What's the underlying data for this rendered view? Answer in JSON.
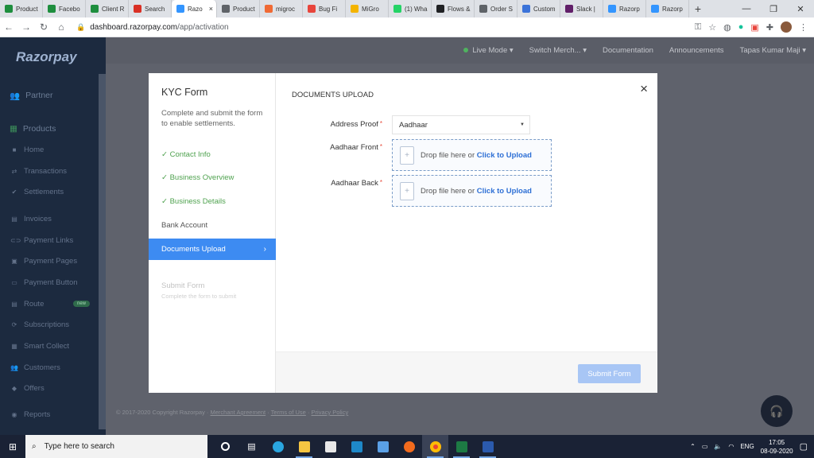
{
  "browser": {
    "tabs": [
      {
        "label": "Product",
        "color": "#1e8e3e"
      },
      {
        "label": "Facebo",
        "color": "#1e8e3e"
      },
      {
        "label": "Client R",
        "color": "#1e8e3e"
      },
      {
        "label": "Search",
        "color": "#d93025"
      },
      {
        "label": "Razo",
        "color": "#3395ff",
        "active": true
      },
      {
        "label": "Product",
        "color": "#5f6368"
      },
      {
        "label": "migroc",
        "color": "#f06a35"
      },
      {
        "label": "Bug Fi",
        "color": "#e8453c"
      },
      {
        "label": "MiGro",
        "color": "#f4b400"
      },
      {
        "label": "(1) Wha",
        "color": "#25d366"
      },
      {
        "label": "Flows &",
        "color": "#202124"
      },
      {
        "label": "Order S",
        "color": "#5f6368"
      },
      {
        "label": "Custom",
        "color": "#3b73d9"
      },
      {
        "label": "Slack |",
        "color": "#611f69"
      },
      {
        "label": "Razorp",
        "color": "#3395ff"
      },
      {
        "label": "Razorp",
        "color": "#3395ff"
      }
    ],
    "active_tab_close": "×",
    "new_tab": "+",
    "url_host": "dashboard.razorpay.com",
    "url_path": "/app/activation"
  },
  "sidebar": {
    "logo": "Razorpay",
    "partner": "Partner",
    "products": "Products",
    "items": [
      {
        "label": "Home",
        "icon": "home-icon",
        "glyph": "■"
      },
      {
        "label": "Transactions",
        "icon": "transactions-icon",
        "glyph": "⇄"
      },
      {
        "label": "Settlements",
        "icon": "settlements-icon",
        "glyph": "✔"
      },
      {
        "label": "Invoices",
        "icon": "invoices-icon",
        "glyph": "▤"
      },
      {
        "label": "Payment Links",
        "icon": "link-icon",
        "glyph": "⊂⊃"
      },
      {
        "label": "Payment Pages",
        "icon": "pages-icon",
        "glyph": "▣"
      },
      {
        "label": "Payment Button",
        "icon": "button-icon",
        "glyph": "▭"
      },
      {
        "label": "Route",
        "icon": "route-icon",
        "glyph": "▤",
        "badge": "new"
      },
      {
        "label": "Subscriptions",
        "icon": "subscriptions-icon",
        "glyph": "⟳"
      },
      {
        "label": "Smart Collect",
        "icon": "smart-collect-icon",
        "glyph": "▦"
      },
      {
        "label": "Customers",
        "icon": "customers-icon",
        "glyph": "👥"
      },
      {
        "label": "Offers",
        "icon": "offers-icon",
        "glyph": "◆"
      },
      {
        "label": "Reports",
        "icon": "reports-icon",
        "glyph": "◉"
      }
    ]
  },
  "topbar": {
    "live_mode": "Live Mode ▾",
    "switch_merchant": "Switch Merch... ▾",
    "documentation": "Documentation",
    "announcements": "Announcements",
    "user": "Tapas Kumar Maji ▾"
  },
  "modal": {
    "title": "KYC Form",
    "subtitle": "Complete and submit the form to enable settlements.",
    "steps": [
      {
        "label": "✓  Contact Info",
        "state": "done"
      },
      {
        "label": "✓  Business Overview",
        "state": "done"
      },
      {
        "label": "✓  Business Details",
        "state": "done"
      },
      {
        "label": "Bank Account",
        "state": "plain"
      },
      {
        "label": "Documents Upload",
        "state": "active"
      }
    ],
    "submit_step": "Submit Form",
    "submit_step_sub": "Complete the form to submit",
    "section_title": "DOCUMENTS UPLOAD",
    "close": "×",
    "address_proof_label": "Address Proof",
    "address_proof_value": "Aadhaar",
    "aadhaar_front_label": "Aadhaar Front",
    "aadhaar_back_label": "Aadhaar Back",
    "drop_text": "Drop file here or ",
    "drop_link": "Click to Upload",
    "required_mark": "*",
    "submit_button": "Submit Form"
  },
  "footer": {
    "copyright": "© 2017-2020 Copyright Razorpay · ",
    "merchant_agreement": "Merchant Agreement",
    "terms": "Terms of Use",
    "privacy": "Privacy Policy",
    "sep1": " · ",
    "sep2": " · "
  },
  "taskbar": {
    "search_placeholder": "Type here to search",
    "language": "ENG",
    "time": "17:05",
    "date": "08-09-2020"
  }
}
